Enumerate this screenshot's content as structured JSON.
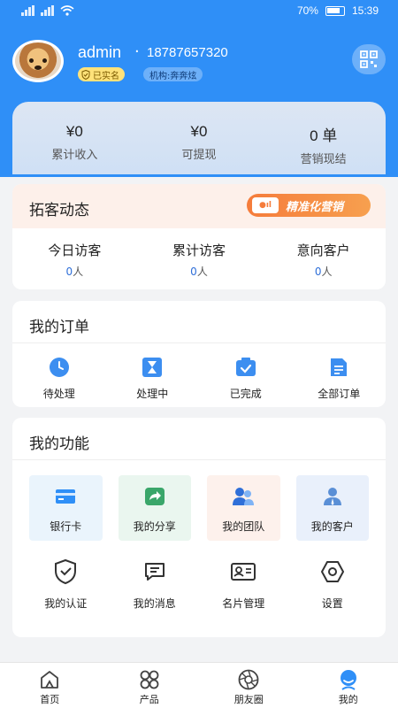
{
  "status_bar": {
    "battery": "70%",
    "time": "15:39"
  },
  "profile": {
    "username": "admin",
    "separator": "·",
    "phone": "18787657320",
    "verified_badge": "已实名",
    "org_badge": "机构:奔奔炫"
  },
  "earnings": [
    {
      "value": "¥0",
      "label": "累计收入"
    },
    {
      "value": "¥0",
      "label": "可提现"
    },
    {
      "value": "0 单",
      "label": "营销现结"
    }
  ],
  "visitors": {
    "title": "拓客动态",
    "promo_label": "精准化营销",
    "stats": [
      {
        "label": "今日访客",
        "value": "0",
        "unit": "人"
      },
      {
        "label": "累计访客",
        "value": "0",
        "unit": "人"
      },
      {
        "label": "意向客户",
        "value": "0",
        "unit": "人"
      }
    ]
  },
  "orders": {
    "title": "我的订单",
    "items": [
      {
        "label": "待处理",
        "icon": "clock-icon"
      },
      {
        "label": "处理中",
        "icon": "hourglass-icon"
      },
      {
        "label": "已完成",
        "icon": "check-box-icon"
      },
      {
        "label": "全部订单",
        "icon": "document-icon"
      }
    ]
  },
  "functions": {
    "title": "我的功能",
    "tiles": [
      {
        "label": "银行卡",
        "icon": "bank-card-icon",
        "bg": "#eaf4fc"
      },
      {
        "label": "我的分享",
        "icon": "share-icon",
        "bg": "#eaf6ef"
      },
      {
        "label": "我的团队",
        "icon": "team-icon",
        "bg": "#fdf1ec"
      },
      {
        "label": "我的客户",
        "icon": "customer-icon",
        "bg": "#e9f0fb"
      }
    ],
    "items": [
      {
        "label": "我的认证",
        "icon": "shield-check-icon"
      },
      {
        "label": "我的消息",
        "icon": "message-icon"
      },
      {
        "label": "名片管理",
        "icon": "id-card-icon"
      },
      {
        "label": "设置",
        "icon": "settings-icon"
      }
    ]
  },
  "bottom_nav": [
    {
      "label": "首页",
      "icon": "home-icon"
    },
    {
      "label": "产品",
      "icon": "products-icon"
    },
    {
      "label": "朋友圈",
      "icon": "moments-icon"
    },
    {
      "label": "我的",
      "icon": "profile-icon",
      "active": true
    }
  ],
  "colors": {
    "primary": "#2f8ff7",
    "accent_orange": "#f57c3b",
    "link_blue": "#2f6fd8"
  }
}
